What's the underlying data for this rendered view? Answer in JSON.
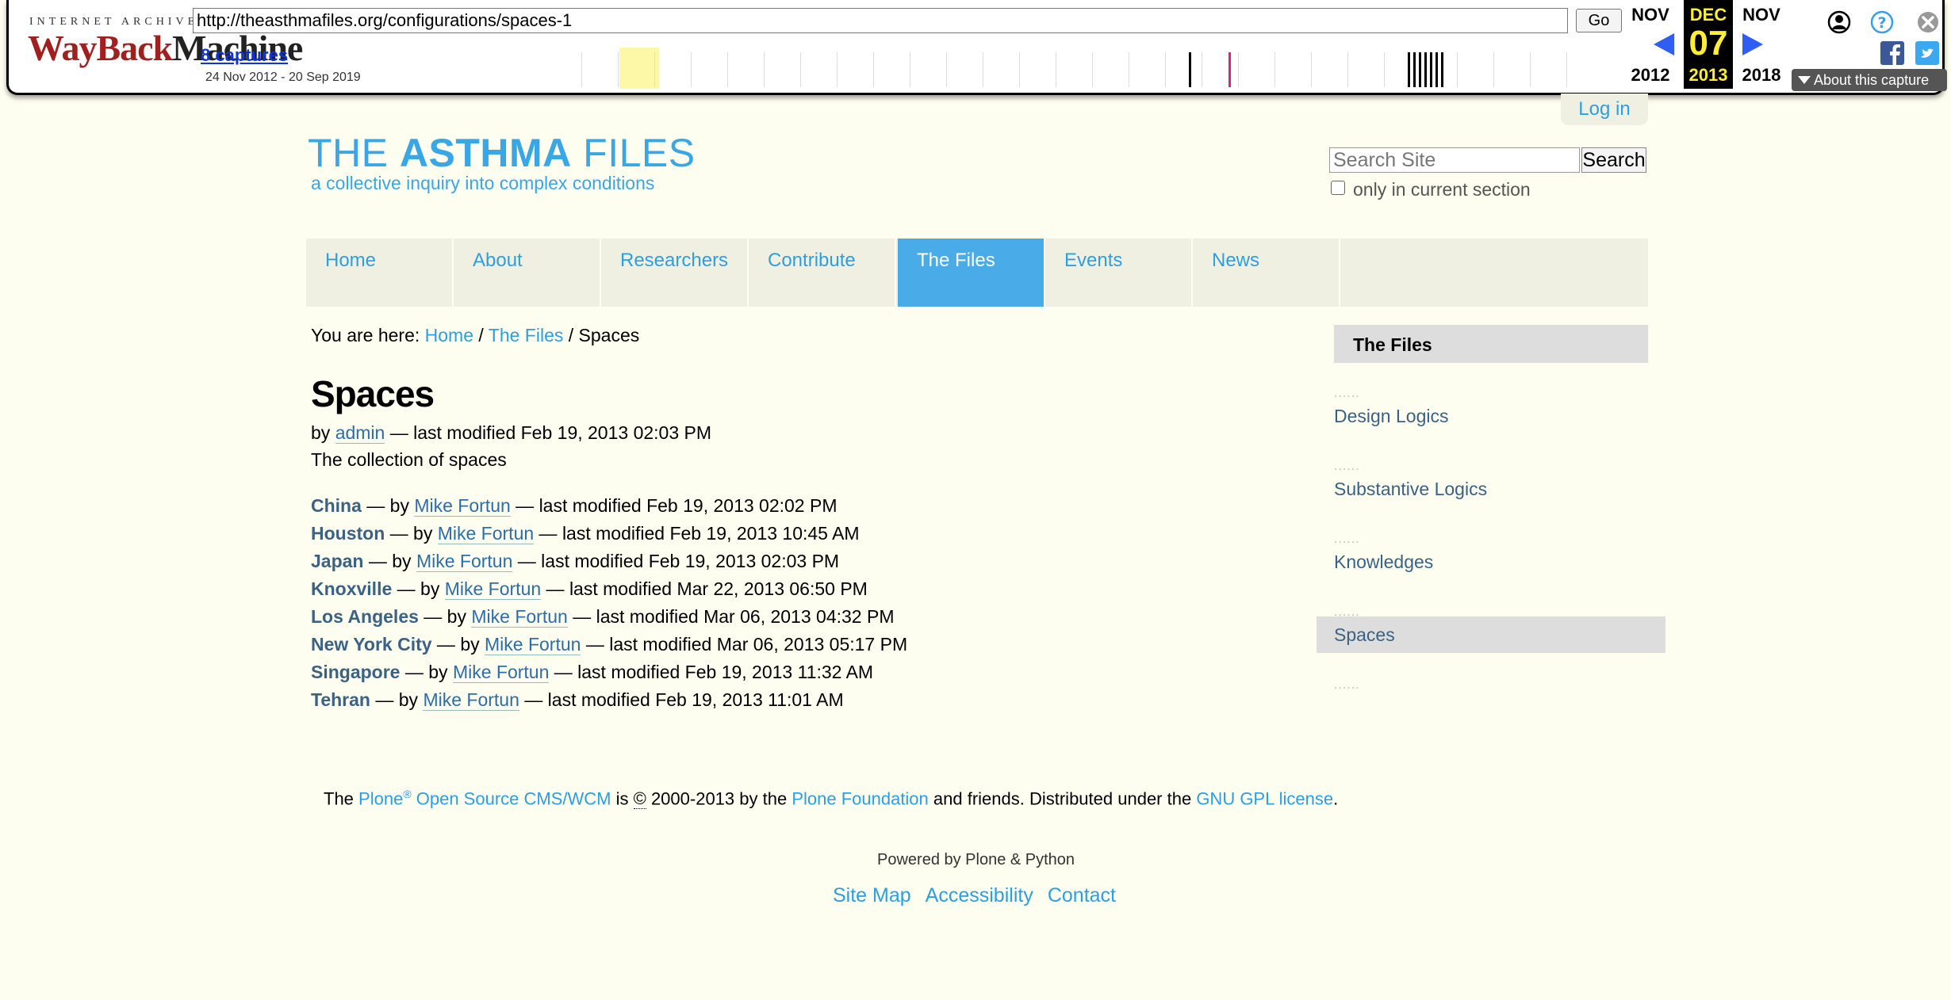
{
  "wayback": {
    "logo_top": "INTERNET ARCHIVE",
    "logo_way": "WayBack",
    "logo_machine": "Machine",
    "url": "http://theasthmafiles.org/configurations/spaces-1",
    "go_label": "Go",
    "captures": "8 captures",
    "date_range": "24 Nov 2012 - 20 Sep 2019",
    "prev_month": "NOV",
    "prev_year": "2012",
    "cur_month": "DEC",
    "cur_day": "07",
    "cur_year": "2013",
    "next_month": "NOV",
    "next_year": "2018",
    "about_label": "About this capture"
  },
  "site": {
    "login": "Log in",
    "logo_the": "THE ",
    "logo_asthma": "ASTHMA",
    "logo_files": " FILES",
    "tagline": "a collective inquiry into complex conditions",
    "search_placeholder": "Search Site",
    "search_button": "Search",
    "only_section": "only in current section"
  },
  "nav": [
    "Home",
    "About",
    "Researchers",
    "Contribute",
    "The Files",
    "Events",
    "News"
  ],
  "nav_active": "The Files",
  "breadcrumb": {
    "prefix": "You are here: ",
    "home": "Home",
    "sep": " / ",
    "files": "The Files",
    "current": "Spaces"
  },
  "page": {
    "title": "Spaces",
    "by": "by ",
    "author": "admin",
    "modified": " — last modified Feb 19, 2013 02:03 PM",
    "description": "The collection of spaces"
  },
  "items": [
    {
      "name": "China",
      "author": "Mike Fortun",
      "modified": "Feb 19, 2013 02:02 PM"
    },
    {
      "name": "Houston",
      "author": "Mike Fortun",
      "modified": "Feb 19, 2013 10:45 AM"
    },
    {
      "name": "Japan",
      "author": "Mike Fortun",
      "modified": "Feb 19, 2013 02:03 PM"
    },
    {
      "name": "Knoxville",
      "author": "Mike Fortun",
      "modified": "Mar 22, 2013 06:50 PM"
    },
    {
      "name": "Los Angeles",
      "author": "Mike Fortun",
      "modified": "Mar 06, 2013 04:32 PM"
    },
    {
      "name": "New York City",
      "author": "Mike Fortun",
      "modified": "Mar 06, 2013 05:17 PM"
    },
    {
      "name": "Singapore",
      "author": "Mike Fortun",
      "modified": "Feb 19, 2013 11:32 AM"
    },
    {
      "name": "Tehran",
      "author": "Mike Fortun",
      "modified": "Feb 19, 2013 11:01 AM"
    }
  ],
  "item_text": {
    "by": " — by ",
    "last_modified": " — last modified "
  },
  "portlet": {
    "title": "The Files",
    "items": [
      "Design Logics",
      "Substantive Logics",
      "Knowledges",
      "Spaces"
    ],
    "dots": "......"
  },
  "footer": {
    "the": "The ",
    "plone": "Plone",
    "reg": "®",
    "cms": " Open Source CMS/WCM",
    "is": " is ",
    "copy": "©",
    "years": " 2000-2013 by the ",
    "foundation": "Plone Foundation",
    "friends": " and friends. Distributed under the ",
    "license": "GNU GPL license",
    "dot": ".",
    "powered": "Powered by Plone & Python",
    "links": [
      "Site Map",
      "Accessibility",
      "Contact"
    ]
  },
  "colors": {
    "accent": "#2d9ee0",
    "nav_active": "#49ace8",
    "page_bg": "#fdfdf0",
    "wayback_current": "#ffee33"
  }
}
